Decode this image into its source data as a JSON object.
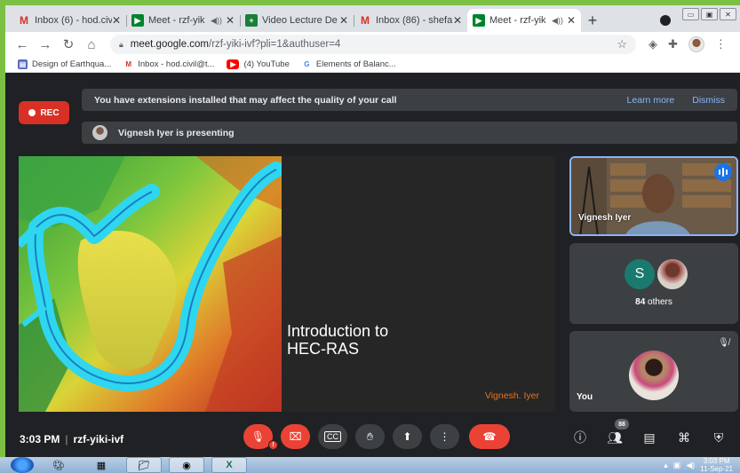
{
  "browser": {
    "tabs": [
      {
        "favicon": "gmail-icon",
        "title": "Inbox (6) - hod.civ",
        "audio": false,
        "active": false
      },
      {
        "favicon": "meet-icon",
        "title": "Meet - rzf-yik",
        "audio": true,
        "active": false
      },
      {
        "favicon": "sheets-icon",
        "title": "Video Lecture De",
        "audio": false,
        "active": false
      },
      {
        "favicon": "gmail-icon",
        "title": "Inbox (86) - shefa",
        "audio": false,
        "active": false
      },
      {
        "favicon": "meet-icon",
        "title": "Meet - rzf-yik",
        "audio": true,
        "active": true
      }
    ],
    "new_tab": "+",
    "url_host": "meet.google.com",
    "url_path": "/rzf-yiki-ivf?pli=1&authuser=4",
    "bookmarks": [
      {
        "icon": "bookmark-icon",
        "label": "Design of Earthqua..."
      },
      {
        "icon": "gmail-icon",
        "label": "Inbox - hod.civil@t..."
      },
      {
        "icon": "youtube-icon",
        "label": "(4) YouTube"
      },
      {
        "icon": "google-icon",
        "label": "Elements of Balanc..."
      }
    ]
  },
  "meet": {
    "rec_label": "REC",
    "banner_text": "You have extensions installed that may affect the quality of your call",
    "learn_more": "Learn more",
    "dismiss": "Dismiss",
    "presenting_text": "Vignesh Iyer is presenting",
    "slide": {
      "title_line1": "Introduction to",
      "title_line2": "HEC-RAS",
      "author": "Vignesh. Iyer"
    },
    "participants": {
      "speaker_name": "Vignesh Iyer",
      "others_initial": "S",
      "others_count": "84",
      "others_label": "others",
      "you_label": "You"
    },
    "time": "3:03 PM",
    "meeting_code": "rzf-yiki-ivf",
    "people_count": "88"
  },
  "taskbar": {
    "clock_time": "3:03 PM",
    "clock_date": "11-Sep-21"
  },
  "colors": {
    "meet_bg": "#202124",
    "danger": "#ea4335",
    "accent": "#8ab4f8",
    "slide_author": "#e8711a"
  }
}
